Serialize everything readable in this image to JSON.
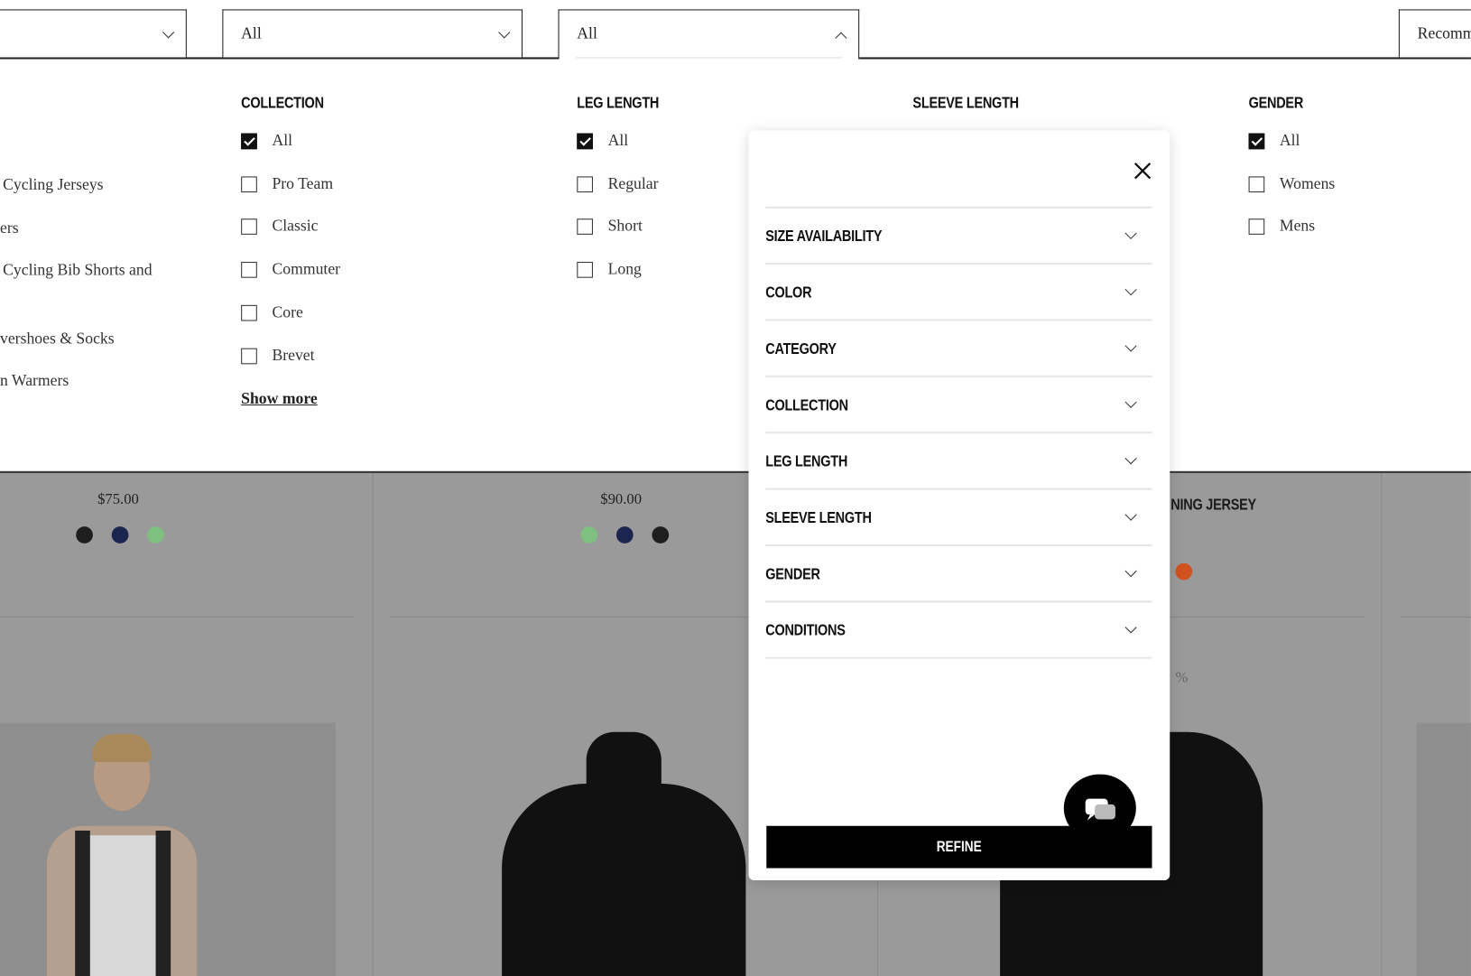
{
  "toolbar": {
    "dropdown_1": {
      "value": ""
    },
    "dropdown_2": {
      "value": "All"
    },
    "dropdown_3": {
      "value": "All"
    },
    "sort": {
      "value": "Recomm"
    }
  },
  "filters": {
    "category_partial": [
      "Cycling Jerseys",
      "ers",
      "Cycling Bib Shorts and",
      "vershoes & Socks",
      "n Warmers"
    ],
    "collection": {
      "title": "COLLECTION",
      "options": [
        {
          "label": "All",
          "checked": true
        },
        {
          "label": "Pro Team",
          "checked": false
        },
        {
          "label": "Classic",
          "checked": false
        },
        {
          "label": "Commuter",
          "checked": false
        },
        {
          "label": "Core",
          "checked": false
        },
        {
          "label": "Brevet",
          "checked": false
        }
      ],
      "show_more": "Show more"
    },
    "leg_length": {
      "title": "LEG LENGTH",
      "options": [
        {
          "label": "All",
          "checked": true
        },
        {
          "label": "Regular",
          "checked": false
        },
        {
          "label": "Short",
          "checked": false
        },
        {
          "label": "Long",
          "checked": false
        }
      ]
    },
    "sleeve_length": {
      "title": "SLEEVE LENGTH"
    },
    "gender": {
      "title": "GENDER",
      "options": [
        {
          "label": "All",
          "checked": true
        },
        {
          "label": "Womens",
          "checked": false
        },
        {
          "label": "Mens",
          "checked": false
        }
      ]
    }
  },
  "products": [
    {
      "price": "$75.00",
      "colors": [
        "#1e1e1e",
        "#1c2550",
        "#7fbf7f"
      ]
    },
    {
      "price": "$90.00",
      "colors": [
        "#7fbf7f",
        "#1c2550",
        "#1e1e1e"
      ]
    },
    {
      "name_partial": "NING JERSEY",
      "colors": [
        "#d0521e"
      ],
      "discount_partial": "%"
    }
  ],
  "modal": {
    "close_icon": "close-icon",
    "sections": [
      "SIZE AVAILABILITY",
      "COLOR",
      "CATEGORY",
      "COLLECTION",
      "LEG LENGTH",
      "SLEEVE LENGTH",
      "GENDER",
      "CONDITIONS"
    ],
    "refine_label": "REFINE",
    "chat_icon": "chat-bubbles-icon"
  }
}
